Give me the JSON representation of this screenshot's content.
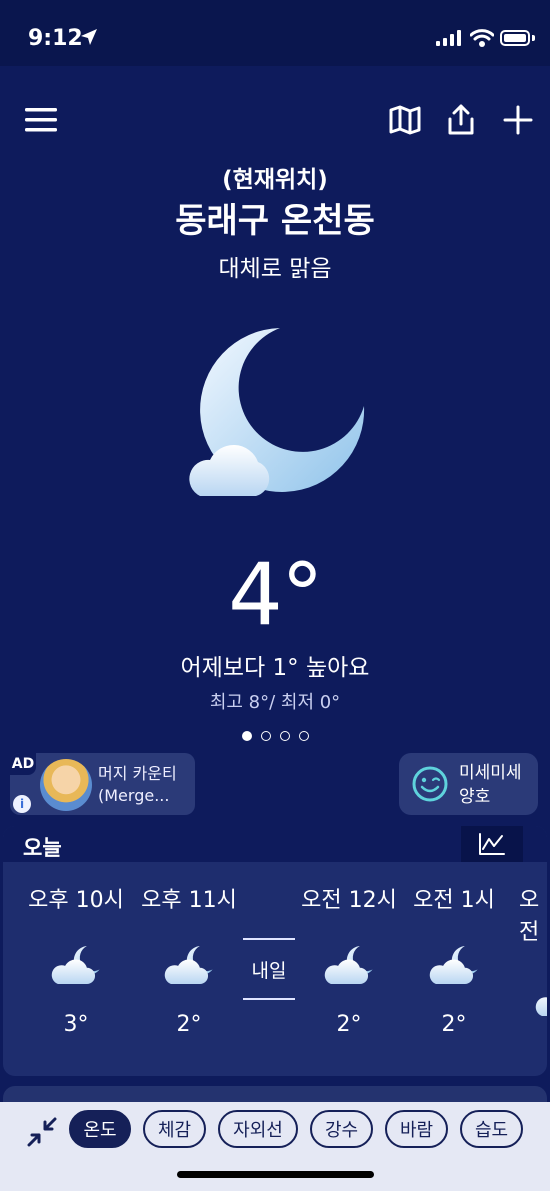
{
  "status_bar": {
    "time": "9:12"
  },
  "location": {
    "prefix": "(현재위치)",
    "name": "동래구 온천동",
    "condition": "대체로 맑음"
  },
  "current": {
    "temperature": "4°",
    "comparison": "어제보다 1° 높아요",
    "high_low": "최고 8°/ 최저 0°",
    "icon": "moon-with-cloud-icon"
  },
  "pager": {
    "total": 4,
    "active": 0
  },
  "ad": {
    "tag": "AD",
    "info": "i",
    "line1": "머지 카운티",
    "line2": "(Merge..."
  },
  "air_quality": {
    "line1": "미세미세",
    "line2": "양호",
    "icon": "smiley-wink-icon"
  },
  "hourly": {
    "title": "오늘",
    "day_divider": "내일",
    "items": [
      {
        "time": "오후 10시",
        "temp": "3°",
        "icon": "night-partly-cloudy-icon"
      },
      {
        "time": "오후 11시",
        "temp": "2°",
        "icon": "night-partly-cloudy-icon"
      },
      {
        "time": "오전 12시",
        "temp": "2°",
        "icon": "night-partly-cloudy-icon"
      },
      {
        "time": "오전 1시",
        "temp": "2°",
        "icon": "night-partly-cloudy-icon"
      },
      {
        "time": "오전",
        "temp": "",
        "icon": "night-partly-cloudy-icon"
      }
    ]
  },
  "tabs": [
    {
      "label": "온도",
      "active": true
    },
    {
      "label": "체감",
      "active": false
    },
    {
      "label": "자외선",
      "active": false
    },
    {
      "label": "강수",
      "active": false
    },
    {
      "label": "바람",
      "active": false
    },
    {
      "label": "습도",
      "active": false
    }
  ],
  "colors": {
    "background": "#0e1b5c",
    "card": "#2b3a78",
    "tab_active": "#152058",
    "bottom_bar": "#e5e8f4"
  }
}
